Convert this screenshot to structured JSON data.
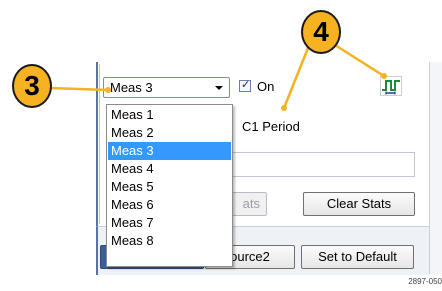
{
  "measurement": {
    "selected": "Meas 3",
    "on_label": "On",
    "on_checked": true,
    "description": "C1 Period",
    "options": [
      "Meas 1",
      "Meas 2",
      "Meas 3",
      "Meas 4",
      "Meas 5",
      "Meas 6",
      "Meas 7",
      "Meas 8"
    ]
  },
  "buttons": {
    "stats_partial": "ats",
    "clear_stats": "Clear Stats",
    "source2_partial": "ource2",
    "set_to_default": "Set to Default"
  },
  "callouts": {
    "three": "3",
    "four": "4"
  },
  "icons": {
    "measure": "period-waveform-icon"
  },
  "colors": {
    "callout_fill": "#f6b221",
    "selection": "#3399ff",
    "waveform_icon": "#1f8a3b"
  },
  "figure_id": "2897-050"
}
